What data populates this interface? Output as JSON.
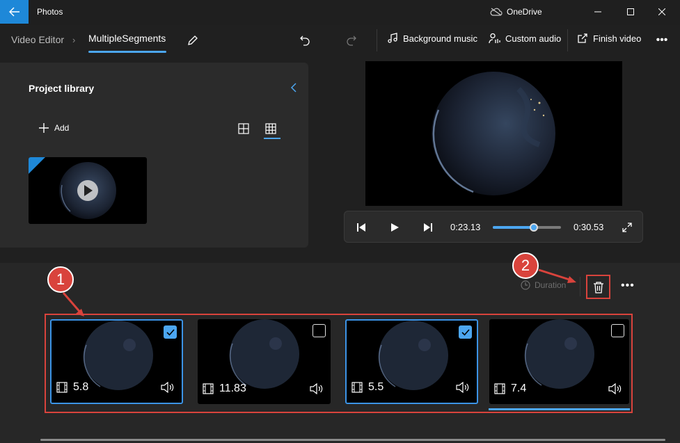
{
  "titlebar": {
    "app_title": "Photos",
    "onedrive_label": "OneDrive",
    "accent_color": "#1e88d8"
  },
  "toolbar": {
    "breadcrumb_root": "Video Editor",
    "breadcrumb_current": "MultipleSegments",
    "background_music_label": "Background music",
    "custom_audio_label": "Custom audio",
    "finish_video_label": "Finish video"
  },
  "library": {
    "title": "Project library",
    "add_label": "Add"
  },
  "player": {
    "current_time": "0:23.13",
    "total_time": "0:30.53",
    "progress_fraction": 0.6
  },
  "storyboard": {
    "duration_label": "Duration",
    "clips": [
      {
        "length": "5.8",
        "selected": true
      },
      {
        "length": "11.83",
        "selected": false
      },
      {
        "length": "5.5",
        "selected": true
      },
      {
        "length": "7.4",
        "selected": false
      }
    ]
  },
  "annotations": {
    "callout_1": "1",
    "callout_2": "2",
    "highlight_color": "#d9433c"
  }
}
